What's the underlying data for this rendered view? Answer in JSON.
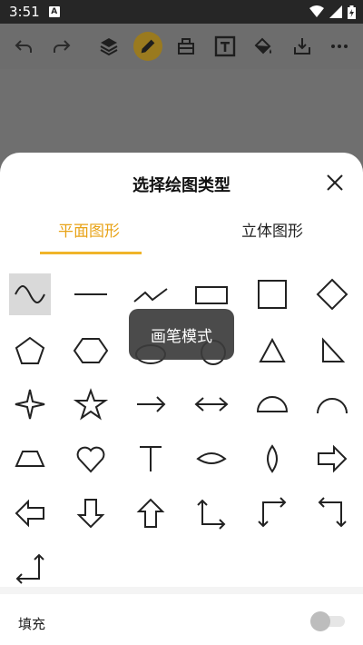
{
  "status_bar": {
    "time": "3:51",
    "badge": "A"
  },
  "toolbar": {
    "icons": [
      "undo-icon",
      "redo-icon",
      "layers-icon",
      "pen-icon",
      "eraser-icon",
      "text-icon",
      "paint-bucket-icon",
      "download-icon",
      "more-icon"
    ],
    "active": "pen-icon",
    "active_color": "#9a7a1f"
  },
  "sheet": {
    "title": "选择绘图类型",
    "tabs": [
      {
        "label": "平面图形",
        "active": true
      },
      {
        "label": "立体图形",
        "active": false
      }
    ],
    "accent_color": "#f0b429",
    "shapes": [
      "wave",
      "line",
      "polyline",
      "rectangle",
      "square",
      "diamond",
      "pentagon",
      "hexagon",
      "ellipse",
      "circle",
      "triangle",
      "right-triangle",
      "four-point-star",
      "five-point-star",
      "arrow-right",
      "double-arrow",
      "semicircle",
      "arc",
      "trapezoid",
      "heart",
      "t-shape",
      "eye",
      "lens",
      "block-arrow-right",
      "block-arrow-left",
      "block-arrow-down",
      "block-arrow-up",
      "elbow-arrow-up-right",
      "elbow-arrow-right-down",
      "elbow-arrow-left-down",
      "elbow-arrow-up-left"
    ],
    "selected_shape": "wave",
    "toast": "画笔模式",
    "fill_label": "填充",
    "fill_enabled": false
  }
}
